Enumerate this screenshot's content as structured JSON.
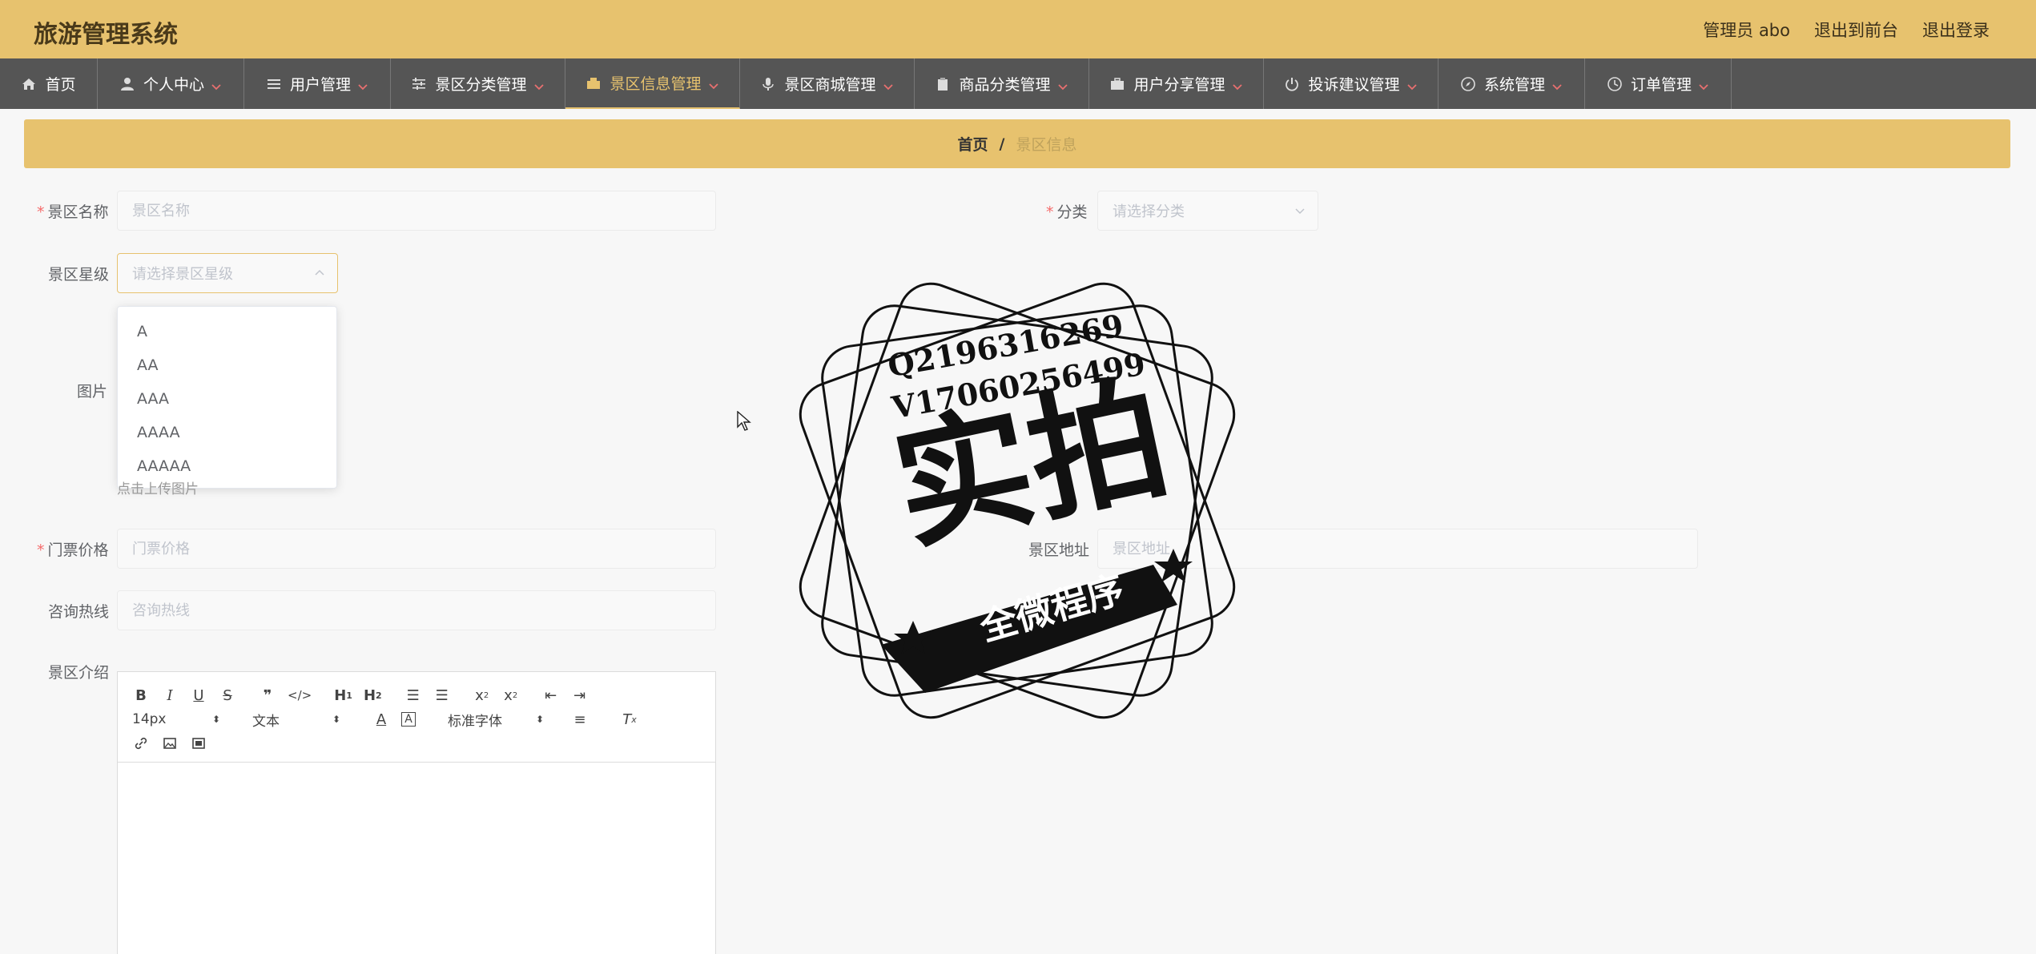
{
  "header": {
    "title": "旅游管理系统",
    "admin": "管理员 abo",
    "to_front": "退出到前台",
    "logout": "退出登录"
  },
  "nav": [
    {
      "label": "首页",
      "icon": "home-icon",
      "chevron": false,
      "active": false
    },
    {
      "label": "个人中心",
      "icon": "user-icon",
      "chevron": true,
      "active": false
    },
    {
      "label": "用户管理",
      "icon": "list-icon",
      "chevron": true,
      "active": false
    },
    {
      "label": "景区分类管理",
      "icon": "sliders-icon",
      "chevron": true,
      "active": false
    },
    {
      "label": "景区信息管理",
      "icon": "info-icon",
      "chevron": true,
      "active": true
    },
    {
      "label": "景区商城管理",
      "icon": "mic-icon",
      "chevron": true,
      "active": false
    },
    {
      "label": "商品分类管理",
      "icon": "clipboard-icon",
      "chevron": true,
      "active": false
    },
    {
      "label": "用户分享管理",
      "icon": "briefcase-icon",
      "chevron": true,
      "active": false
    },
    {
      "label": "投诉建议管理",
      "icon": "power-icon",
      "chevron": true,
      "active": false
    },
    {
      "label": "系统管理",
      "icon": "compass-icon",
      "chevron": true,
      "active": false
    },
    {
      "label": "订单管理",
      "icon": "clock-icon",
      "chevron": true,
      "active": false
    }
  ],
  "colors": {
    "accent": "#e7c26e",
    "nav_bg": "#555555",
    "required": "#f56c6c"
  },
  "breadcrumb": {
    "home": "首页",
    "separator": "/",
    "current": "景区信息"
  },
  "form": {
    "name_label": "景区名称",
    "name_placeholder": "景区名称",
    "category_label": "分类",
    "category_placeholder": "请选择分类",
    "star_label": "景区星级",
    "star_placeholder": "请选择景区星级",
    "star_options": [
      "A",
      "AA",
      "AAA",
      "AAAA",
      "AAAAA"
    ],
    "image_label": "图片",
    "upload_hint": "点击上传图片",
    "price_label": "门票价格",
    "price_placeholder": "门票价格",
    "address_label": "景区地址",
    "address_placeholder": "景区地址",
    "hotline_label": "咨询热线",
    "hotline_placeholder": "咨询热线",
    "intro_label": "景区介绍"
  },
  "editor": {
    "font_size": "14px",
    "text_type": "文本",
    "font_family": "标准字体"
  },
  "watermark": {
    "line1": "Q2196316269",
    "line2": "V17060256499",
    "main": "实拍",
    "banner": "全微程序"
  }
}
